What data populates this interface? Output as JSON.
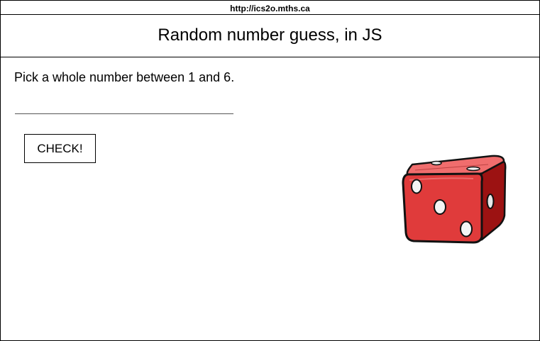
{
  "page": {
    "url": "http://ics2o.mths.ca",
    "title": "Random number guess, in JS",
    "prompt": "Pick a whole number between 1 and 6."
  },
  "input": {
    "value": "",
    "placeholder": ""
  },
  "button": {
    "label": "CHECK!"
  },
  "image": {
    "icon": "dice-icon",
    "color": "#e03b3b"
  }
}
